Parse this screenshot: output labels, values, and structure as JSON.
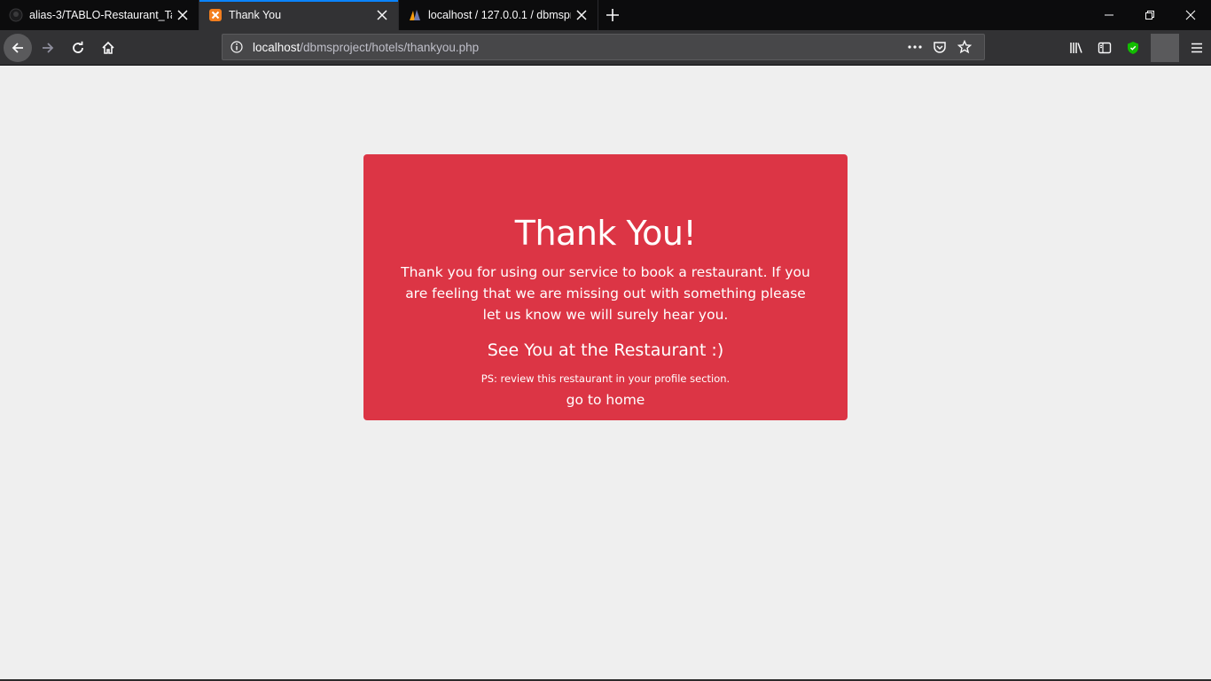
{
  "browser": {
    "tabs": [
      {
        "title": "alias-3/TABLO-Restaurant_Tabl",
        "icon": "github-icon",
        "active": false
      },
      {
        "title": "Thank You",
        "icon": "xampp-icon",
        "active": true
      },
      {
        "title": "localhost / 127.0.0.1 / dbmspro",
        "icon": "phpmyadmin-icon",
        "active": false
      }
    ],
    "url": {
      "host": "localhost",
      "path": "/dbmsproject/hotels/thankyou.php"
    }
  },
  "page": {
    "background_color": "#efefef",
    "card": {
      "color": "#dc3545",
      "title": "Thank You!",
      "message": "Thank you for using our service to book a restaurant. If you are feeling that we are missing out with something please let us know we will surely hear you.",
      "tagline": "See You at the Restaurant :)",
      "ps": "PS: review this restaurant in your profile section.",
      "home_link": "go to home"
    }
  }
}
